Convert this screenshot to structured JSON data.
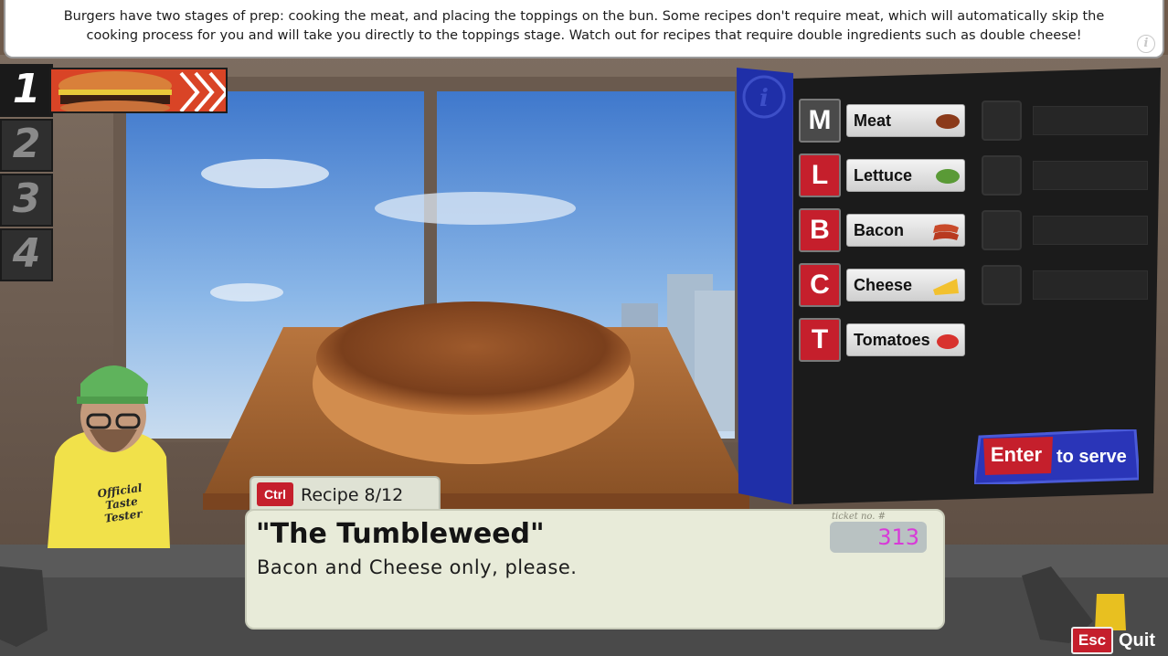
{
  "tip": {
    "text": "Burgers have two stages of prep: cooking the meat, and placing the toppings on the bun. Some recipes don't require meat, which will automatically skip the cooking process for you and will take you directly to the toppings stage. Watch out for recipes that require double ingredients such as double cheese!",
    "icon": "info-icon"
  },
  "order_slots": [
    {
      "number": "1",
      "active": true
    },
    {
      "number": "2",
      "active": false
    },
    {
      "number": "3",
      "active": false
    },
    {
      "number": "4",
      "active": false
    }
  ],
  "ingredients": [
    {
      "key": "M",
      "label": "Meat",
      "key_color": "#4a4a4a",
      "icon": "meat-icon"
    },
    {
      "key": "L",
      "label": "Lettuce",
      "key_color": "#c51f2c",
      "icon": "lettuce-icon"
    },
    {
      "key": "B",
      "label": "Bacon",
      "key_color": "#c51f2c",
      "icon": "bacon-icon"
    },
    {
      "key": "C",
      "label": "Cheese",
      "key_color": "#c51f2c",
      "icon": "cheese-icon"
    },
    {
      "key": "T",
      "label": "Tomatoes",
      "key_color": "#c51f2c",
      "icon": "tomato-icon"
    }
  ],
  "serve": {
    "key": "Enter",
    "label": "to serve"
  },
  "recipe": {
    "ctrl_key": "Ctrl",
    "count": "Recipe 8/12",
    "name": "\"The Tumbleweed\"",
    "description": "Bacon and Cheese only, please.",
    "ticket_caption": "ticket no. #",
    "ticket_number": "313"
  },
  "character": {
    "shirt_text": "Official Taste Tester"
  },
  "quit": {
    "key": "Esc",
    "label": "Quit"
  },
  "colors": {
    "accent_red": "#c51f2c",
    "panel_blue": "#1f2fa8",
    "ticket_pink": "#d83ad8"
  }
}
